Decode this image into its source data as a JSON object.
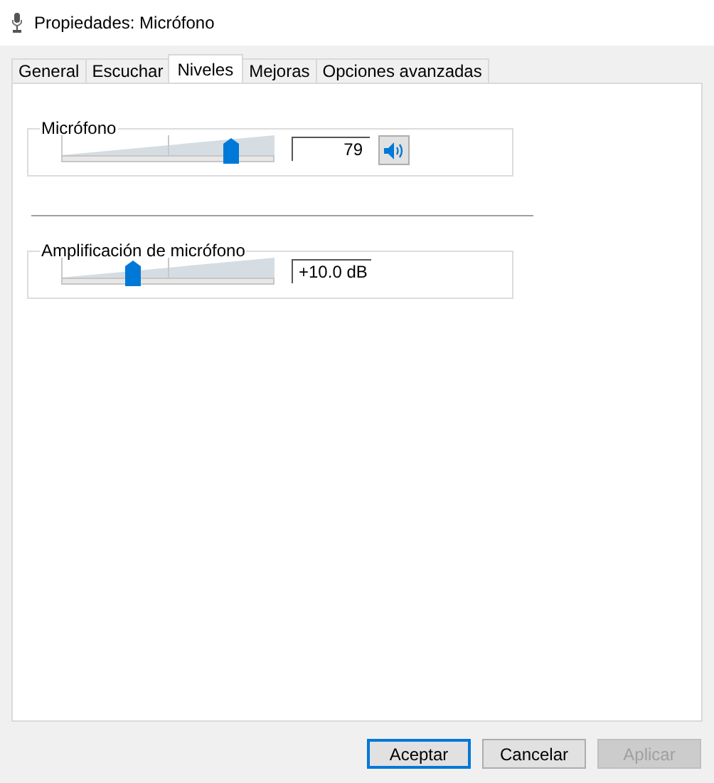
{
  "window": {
    "title": "Propiedades: Micrófono"
  },
  "tabs": [
    {
      "label": "General",
      "selected": false
    },
    {
      "label": "Escuchar",
      "selected": false
    },
    {
      "label": "Niveles",
      "selected": true
    },
    {
      "label": "Mejoras",
      "selected": false
    },
    {
      "label": "Opciones avanzadas",
      "selected": false
    }
  ],
  "groups": [
    {
      "kind": "volume",
      "title": "Micrófono",
      "level": 0.79,
      "reading": "79"
    },
    {
      "kind": "boost",
      "title": "Amplificación de micrófono",
      "level": 0.33,
      "reading": "+10.0 dB"
    }
  ],
  "buttons": [
    {
      "label": "Aceptar",
      "default": true,
      "disabled": false
    },
    {
      "label": "Cancelar",
      "default": false,
      "disabled": false
    },
    {
      "label": "Aplicar",
      "default": false,
      "disabled": true
    }
  ]
}
